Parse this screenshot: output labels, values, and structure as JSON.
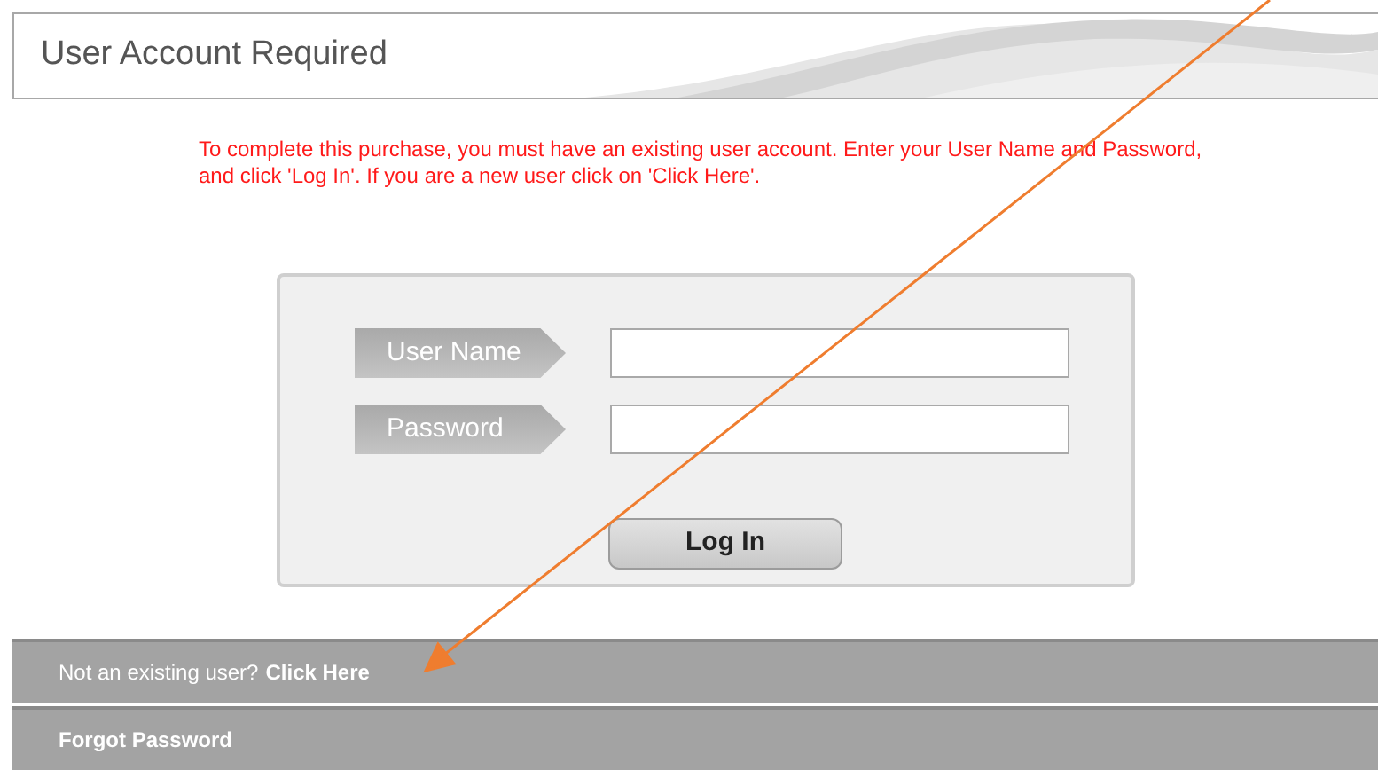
{
  "header": {
    "title": "User Account Required"
  },
  "message": "To complete this purchase, you must have an existing user account. Enter your User Name and Password, and click 'Log In'. If you are a new user click on 'Click Here'.",
  "login_form": {
    "fields": [
      {
        "label": "User Name"
      },
      {
        "label": "Password"
      }
    ],
    "button": "Log In"
  },
  "links": [
    {
      "text": "Not an existing user?",
      "link": "Click Here"
    },
    {
      "link": "Forgot Password"
    }
  ]
}
